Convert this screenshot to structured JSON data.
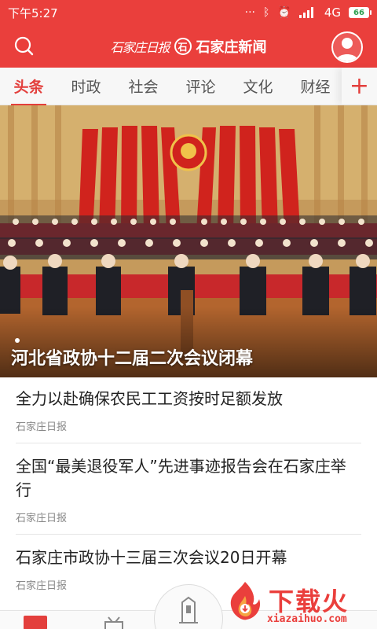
{
  "status_bar": {
    "time": "下午5:27",
    "network": "4G",
    "battery": "66"
  },
  "header": {
    "logo_calligraphy": "石家庄日报",
    "logo_mark": "石",
    "logo_name": "石家庄新闻",
    "search_icon": "search-icon",
    "avatar_icon": "user-icon"
  },
  "tabs": [
    {
      "label": "头条",
      "active": true
    },
    {
      "label": "时政"
    },
    {
      "label": "社会"
    },
    {
      "label": "评论"
    },
    {
      "label": "文化"
    },
    {
      "label": "财经"
    }
  ],
  "tab_add_label": "+",
  "hero": {
    "caption": "河北省政协十二届二次会议闭幕"
  },
  "news": [
    {
      "title": "全力以赴确保农民工工资按时足额发放",
      "source": "石家庄日报"
    },
    {
      "title": "全国“最美退役军人”先进事迹报告会在石家庄举行",
      "source": "石家庄日报"
    },
    {
      "title": "石家庄市政协十三届三次会议20日开幕",
      "source": "石家庄日报"
    }
  ],
  "watermark": {
    "text": "下载火",
    "url": "xiazaihuo.com"
  },
  "colors": {
    "brand_red": "#ea3f3c",
    "tab_active": "#e33f3c"
  }
}
